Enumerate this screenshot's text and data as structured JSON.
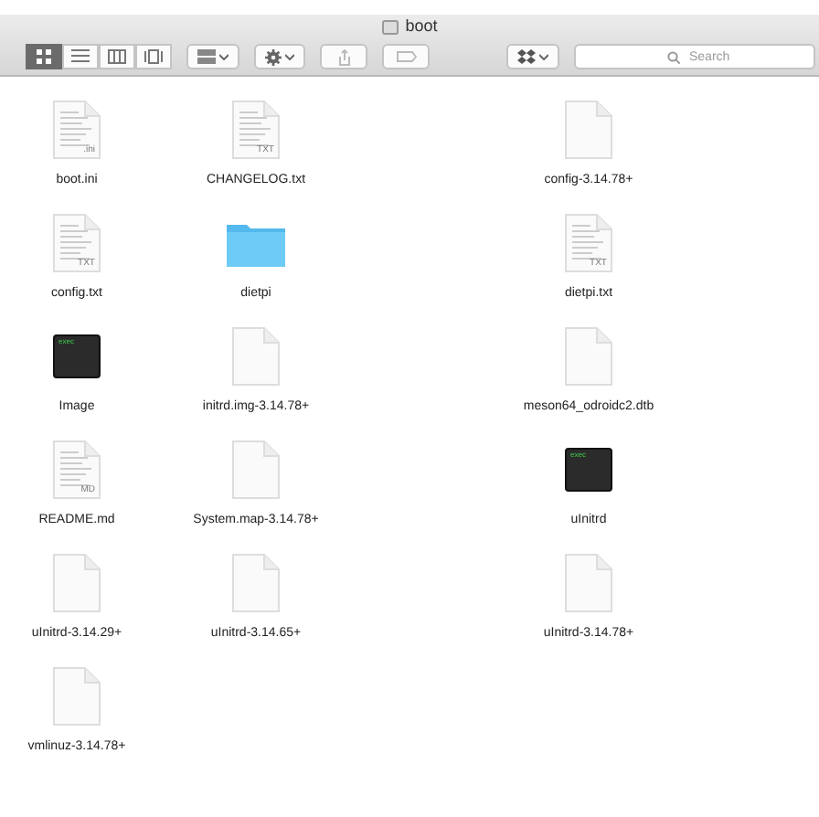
{
  "window": {
    "title": "boot"
  },
  "toolbar": {
    "view_buttons": [
      {
        "selected": true
      },
      {
        "selected": false
      },
      {
        "selected": false
      },
      {
        "selected": false
      }
    ],
    "search": {
      "placeholder": "Search"
    }
  },
  "files": [
    {
      "name": "boot.ini",
      "kind": "document",
      "icon_label": ".ini"
    },
    {
      "name": "CHANGELOG.txt",
      "kind": "document",
      "icon_label": "TXT"
    },
    {
      "name": "config-3.14.78+",
      "kind": "blank"
    },
    {
      "name": "config.txt",
      "kind": "document",
      "icon_label": "TXT"
    },
    {
      "name": "dietpi",
      "kind": "folder"
    },
    {
      "name": "dietpi.txt",
      "kind": "document",
      "icon_label": "TXT"
    },
    {
      "name": "Image",
      "kind": "exec",
      "icon_label": "exec"
    },
    {
      "name": "initrd.img-3.14.78+",
      "kind": "blank"
    },
    {
      "name": "meson64_odroidc2.dtb",
      "kind": "blank"
    },
    {
      "name": "README.md",
      "kind": "document",
      "icon_label": "MD"
    },
    {
      "name": "System.map-3.14.78+",
      "kind": "blank"
    },
    {
      "name": "uInitrd",
      "kind": "exec",
      "icon_label": "exec"
    },
    {
      "name": "uInitrd-3.14.29+",
      "kind": "blank"
    },
    {
      "name": "uInitrd-3.14.65+",
      "kind": "blank"
    },
    {
      "name": "uInitrd-3.14.78+",
      "kind": "blank"
    },
    {
      "name": "vmlinuz-3.14.78+",
      "kind": "blank"
    }
  ]
}
